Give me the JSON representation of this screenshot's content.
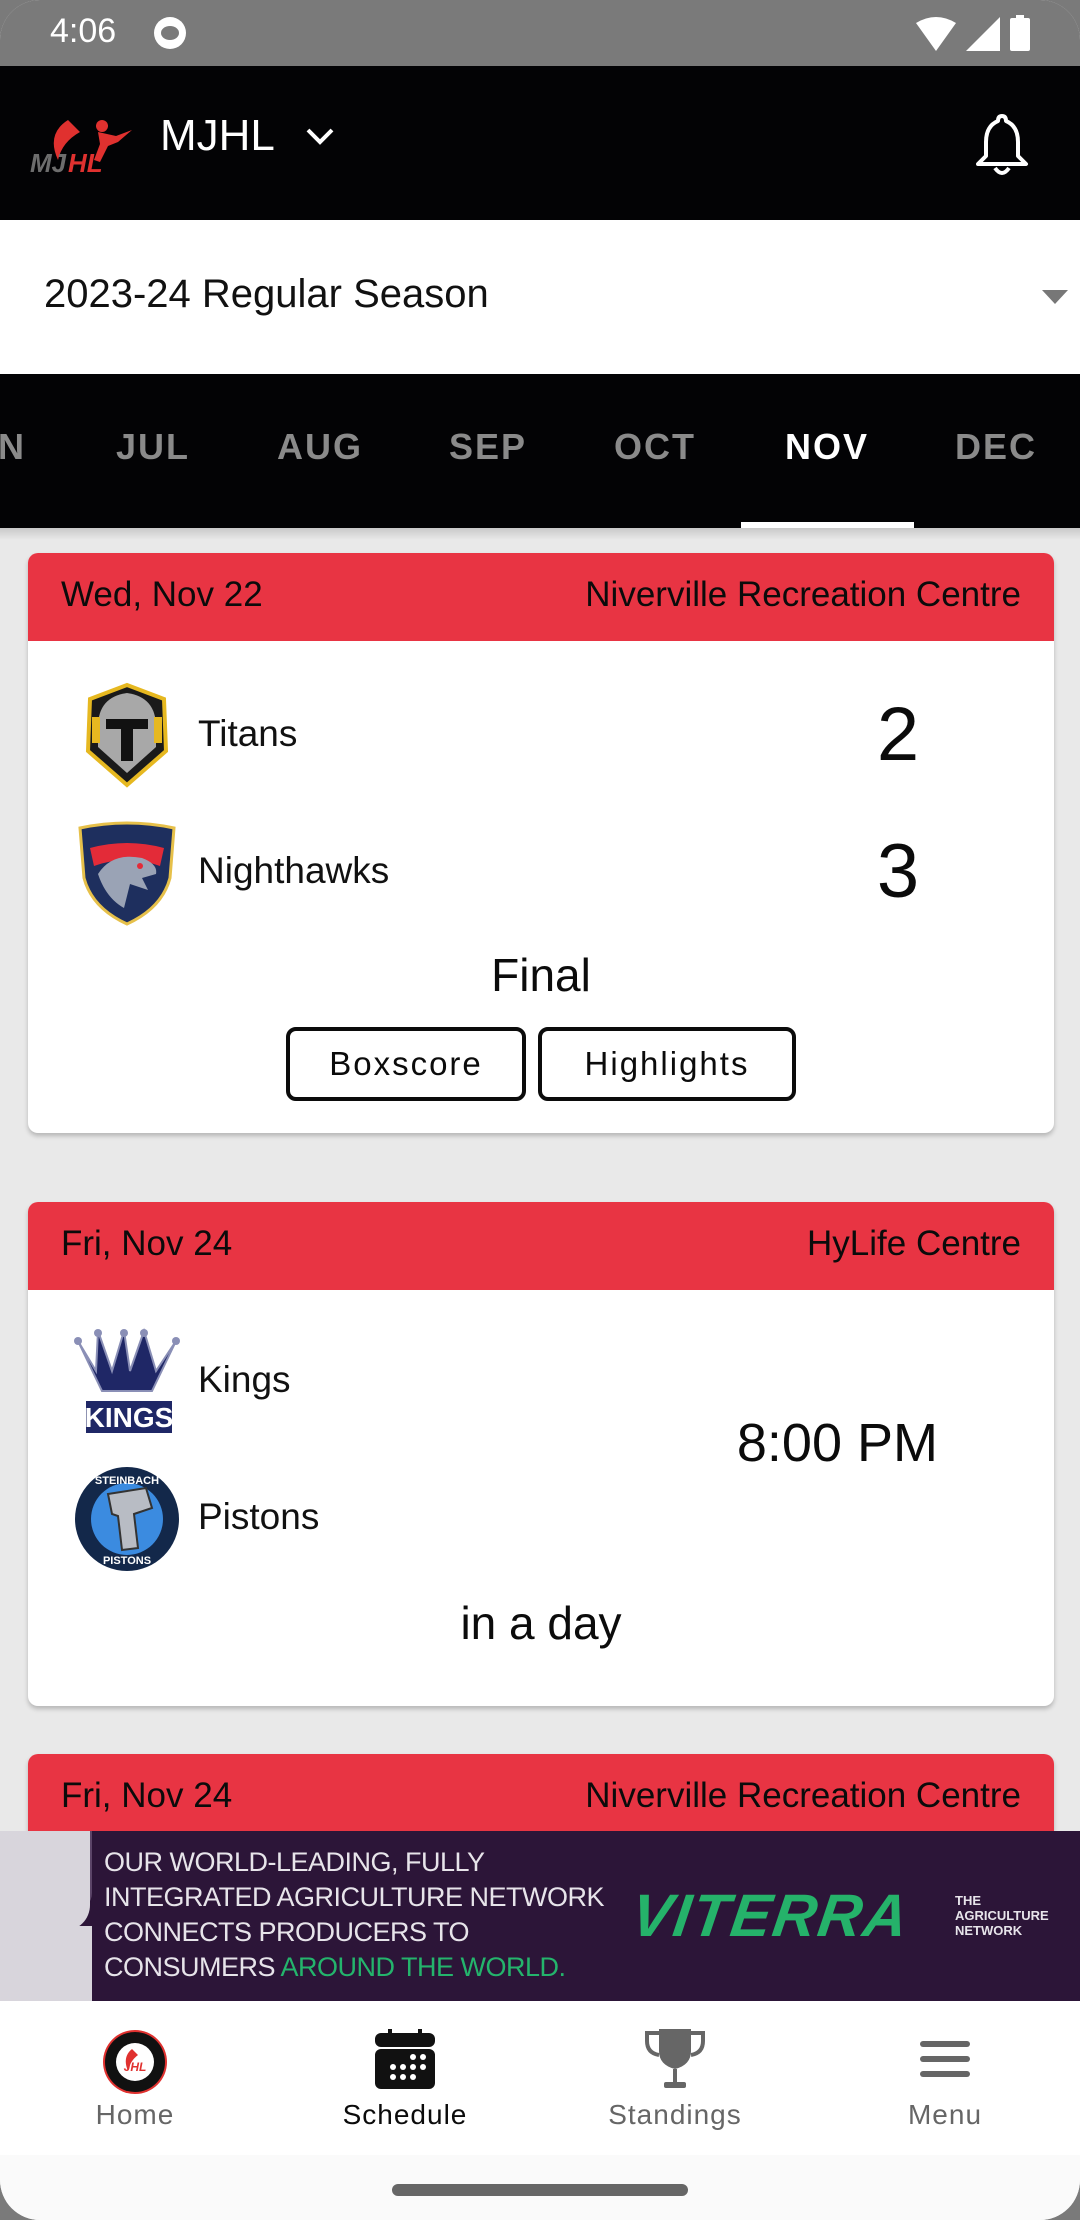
{
  "status_bar": {
    "time": "4:06",
    "icons": [
      "app-notification-icon",
      "wifi-icon",
      "cellular-signal-icon",
      "battery-icon"
    ]
  },
  "header": {
    "league_name": "MJHL",
    "logo": "mjhl-logo",
    "notifications_icon": "bell-icon"
  },
  "season_select": {
    "selected": "2023-24 Regular Season"
  },
  "month_tabs": {
    "items": [
      "JUN",
      "JUL",
      "AUG",
      "SEP",
      "OCT",
      "NOV",
      "DEC"
    ],
    "visible_partial_first": "N",
    "active": "NOV"
  },
  "games": [
    {
      "date": "Wed, Nov 22",
      "venue": "Niverville Recreation Centre",
      "teams": [
        {
          "name": "Titans",
          "score": "2",
          "logo": "titans-logo"
        },
        {
          "name": "Nighthawks",
          "score": "3",
          "logo": "nighthawks-logo"
        }
      ],
      "status": "Final",
      "buttons": [
        "Boxscore",
        "Highlights"
      ]
    },
    {
      "date": "Fri, Nov 24",
      "venue": "HyLife Centre",
      "teams": [
        {
          "name": "Kings",
          "logo": "kings-logo"
        },
        {
          "name": "Pistons",
          "logo": "pistons-logo"
        }
      ],
      "time": "8:00 PM",
      "status": "in a day"
    },
    {
      "date": "Fri, Nov 24",
      "venue": "Niverville Recreation Centre"
    }
  ],
  "ad": {
    "line1": "OUR WORLD-LEADING, FULLY",
    "line2": "INTEGRATED AGRICULTURE NETWORK",
    "line3": "CONNECTS PRODUCERS TO",
    "line4_a": "CONSUMERS ",
    "line4_b": "AROUND THE WORLD.",
    "brand": "VITERRA",
    "tagline_1": "THE",
    "tagline_2": "AGRICULTURE",
    "tagline_3": "NETWORK"
  },
  "bottom_nav": {
    "items": [
      {
        "label": "Home",
        "icon": "league-badge-icon"
      },
      {
        "label": "Schedule",
        "icon": "calendar-icon"
      },
      {
        "label": "Standings",
        "icon": "trophy-icon"
      },
      {
        "label": "Menu",
        "icon": "hamburger-menu-icon"
      }
    ],
    "active": "Schedule"
  },
  "colors": {
    "header_bg": "#030305",
    "card_header": "#e83443",
    "ad_bg": "#2c1538",
    "ad_accent": "#25b26a",
    "inactive_tab": "#8a8a8a"
  }
}
